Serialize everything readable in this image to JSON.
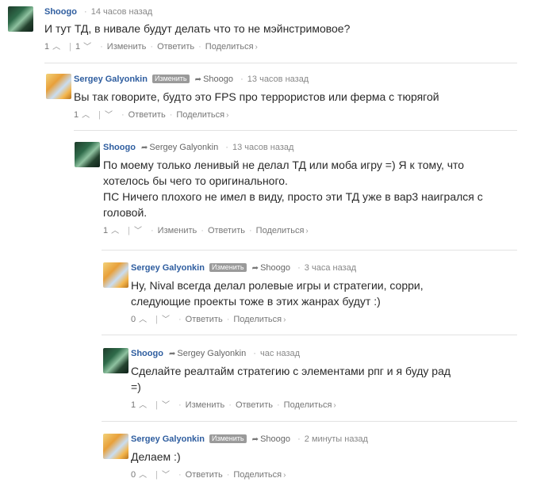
{
  "badge_label": "Изменить",
  "comments": [
    {
      "author": "Shoogo",
      "reply_to": "",
      "time": "14 часов назад",
      "lines": [
        "И тут ТД, в нивале будут делать что то не мэйнстримовое?"
      ],
      "upvotes": "1",
      "downvotes": "1",
      "edit": "Изменить",
      "reply": "Ответить",
      "share": "Поделиться"
    },
    {
      "author": "Sergey Galyonkin",
      "reply_to": "Shoogo",
      "time": "13 часов назад",
      "lines": [
        "Вы так говорите, будто это FPS про террористов или ферма с тюрягой"
      ],
      "upvotes": "1",
      "reply": "Ответить",
      "share": "Поделиться"
    },
    {
      "author": "Shoogo",
      "reply_to": "Sergey Galyonkin",
      "time": "13 часов назад",
      "lines": [
        "По моему только ленивый не делал ТД или моба игру =) Я к тому, что",
        "хотелось бы чего то оригинального.",
        "ПС Ничего плохого не имел в виду, просто эти ТД уже в вар3 наигрался с",
        "головой."
      ],
      "upvotes": "1",
      "edit": "Изменить",
      "reply": "Ответить",
      "share": "Поделиться"
    },
    {
      "author": "Sergey Galyonkin",
      "reply_to": "Shoogo",
      "time": "3 часа назад",
      "lines": [
        "Ну, Nival всегда делал ролевые игры и стратегии, сорри,",
        "следующие проекты тоже в этих жанрах будут :)"
      ],
      "upvotes": "0",
      "reply": "Ответить",
      "share": "Поделиться"
    },
    {
      "author": "Shoogo",
      "reply_to": "Sergey Galyonkin",
      "time": "час назад",
      "lines": [
        "Сделайте реалтайм стратегию с элементами рпг и я буду рад",
        "=)"
      ],
      "upvotes": "1",
      "edit": "Изменить",
      "reply": "Ответить",
      "share": "Поделиться"
    },
    {
      "author": "Sergey Galyonkin",
      "reply_to": "Shoogo",
      "time": "2 минуты назад",
      "lines": [
        "Делаем :)"
      ],
      "upvotes": "0",
      "reply": "Ответить",
      "share": "Поделиться"
    }
  ]
}
